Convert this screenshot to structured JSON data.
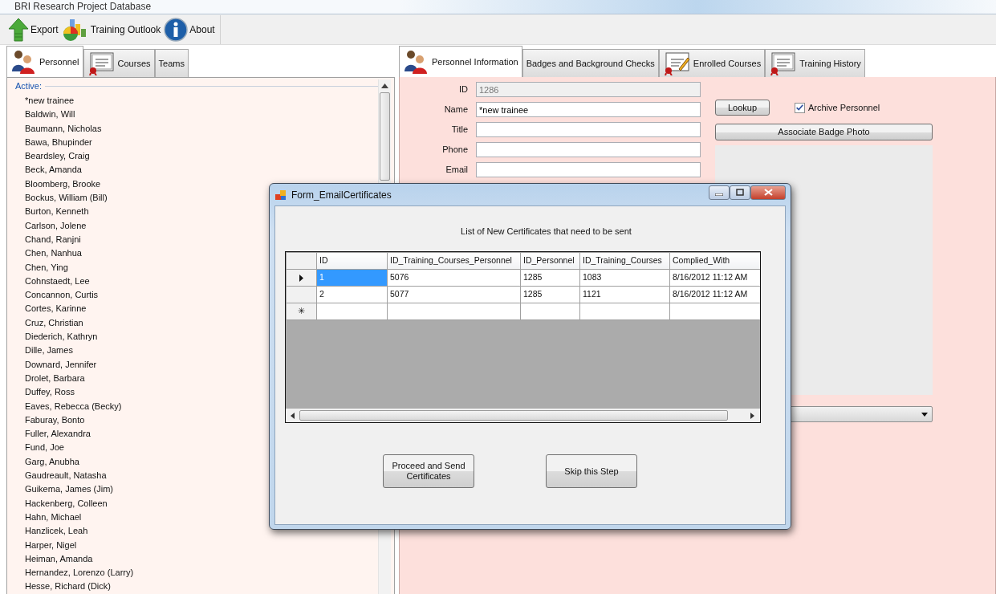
{
  "window": {
    "title": "BRI Research Project Database"
  },
  "toolbar": [
    {
      "label": "Export",
      "kind": "export"
    },
    {
      "label": "Training Outlook",
      "kind": "chart"
    },
    {
      "label": "About",
      "kind": "info"
    }
  ],
  "left_tabs": [
    {
      "label": "Personnel",
      "kind": "people",
      "selected": true
    },
    {
      "label": "Courses",
      "kind": "certificate",
      "selected": false
    },
    {
      "label": "Teams",
      "kind": "plain",
      "selected": false
    }
  ],
  "personnel_list": {
    "group": "Active:",
    "items": [
      "*new trainee",
      "Baldwin, Will",
      "Baumann, Nicholas",
      "Bawa, Bhupinder",
      "Beardsley, Craig",
      "Beck, Amanda",
      "Bloomberg, Brooke",
      "Bockus, William (Bill)",
      "Burton, Kenneth",
      "Carlson, Jolene",
      "Chand, Ranjni",
      "Chen, Nanhua",
      "Chen, Ying",
      "Cohnstaedt, Lee",
      "Concannon, Curtis",
      "Cortes, Karinne",
      "Cruz, Christian",
      "Diederich, Kathryn",
      "Dille, James",
      "Downard, Jennifer",
      "Drolet, Barbara",
      "Duffey, Ross",
      "Eaves, Rebecca (Becky)",
      "Faburay, Bonto",
      "Fuller, Alexandra",
      "Fund, Joe",
      "Garg, Anubha",
      "Gaudreault, Natasha",
      "Guikema, James (Jim)",
      "Hackenberg, Colleen",
      "Hahn, Michael",
      "Hanzlicek, Leah",
      "Harper, Nigel",
      "Heiman, Amanda",
      "Hernandez, Lorenzo (Larry)",
      "Hesse, Richard (Dick)"
    ]
  },
  "right_tabs": [
    {
      "label": "Personnel Information",
      "kind": "people",
      "selected": true
    },
    {
      "label": "Badges and Background Checks",
      "kind": "plain",
      "selected": false
    },
    {
      "label": "Enrolled Courses",
      "kind": "pen",
      "selected": false
    },
    {
      "label": "Training History",
      "kind": "certificate",
      "selected": false
    }
  ],
  "form": {
    "fields": [
      {
        "label": "ID",
        "value": "1286",
        "disabled": true
      },
      {
        "label": "Name",
        "value": "*new trainee",
        "disabled": false
      },
      {
        "label": "Title",
        "disabled": false
      },
      {
        "label": "Phone",
        "disabled": false
      },
      {
        "label": "Email",
        "disabled": false
      }
    ],
    "lookup_button": "Lookup",
    "archive": {
      "label": "Archive Personnel",
      "checked": true
    },
    "badge_button": "Associate Badge Photo"
  },
  "dialog": {
    "title": "Form_EmailCertificates",
    "caption": "List of New Certificates that need to be sent",
    "columns": [
      "ID",
      "ID_Training_Courses_Personnel",
      "ID_Personnel",
      "ID_Training_Courses",
      "Complied_With"
    ],
    "rows": [
      {
        "current": true,
        "cells": [
          {
            "text": "1",
            "selected": true
          },
          {
            "text": "5076",
            "selected": false
          },
          {
            "text": "1285",
            "selected": false
          },
          {
            "text": "1083",
            "selected": false
          },
          {
            "text": "8/16/2012 11:12 AM",
            "selected": false
          }
        ]
      },
      {
        "current": false,
        "cells": [
          {
            "text": "2",
            "selected": false
          },
          {
            "text": "5077",
            "selected": false
          },
          {
            "text": "1285",
            "selected": false
          },
          {
            "text": "1121",
            "selected": false
          },
          {
            "text": "8/16/2012 11:12 AM",
            "selected": false
          }
        ]
      }
    ],
    "new_row_marker": "✳",
    "buttons": [
      "Proceed and Send Certificates",
      "Skip this Step"
    ]
  }
}
